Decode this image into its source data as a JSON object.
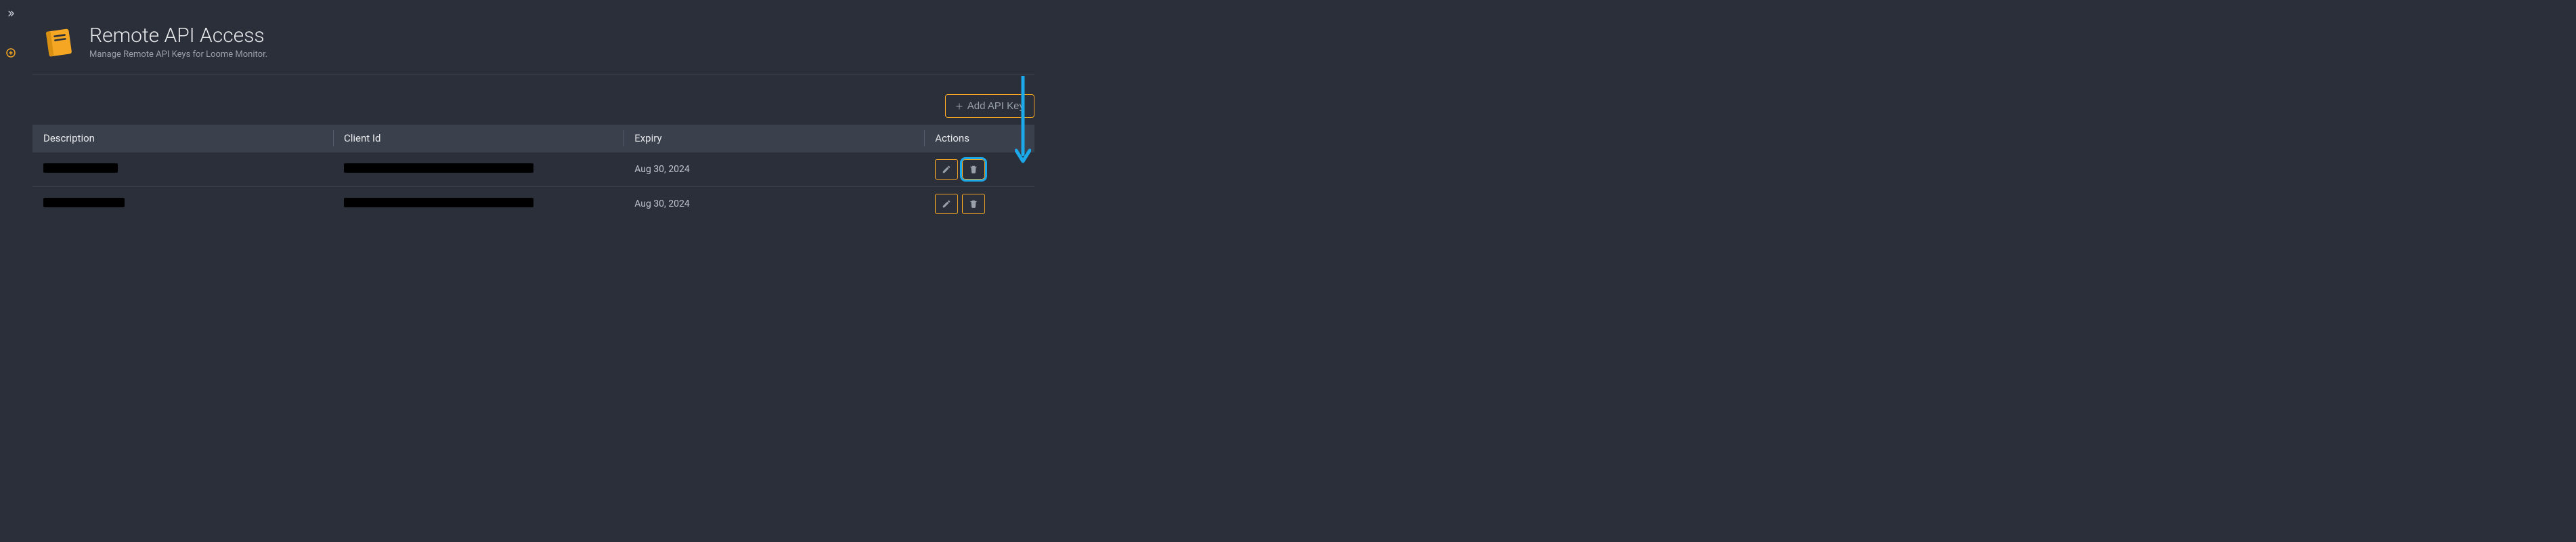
{
  "leftRail": {
    "expandTooltip": "Expand",
    "addTooltip": "Add"
  },
  "header": {
    "title": "Remote API Access",
    "subtitle": "Manage Remote API Keys for Loome Monitor."
  },
  "toolbar": {
    "addKeyLabel": "Add API Key"
  },
  "table": {
    "columns": {
      "description": "Description",
      "clientId": "Client Id",
      "expiry": "Expiry",
      "actions": "Actions"
    },
    "rows": [
      {
        "description": "",
        "clientId": "",
        "expiry": "Aug 30, 2024"
      },
      {
        "description": "",
        "clientId": "",
        "expiry": "Aug 30, 2024"
      }
    ]
  },
  "colors": {
    "accent": "#f5a623",
    "annotation": "#1ba9e9",
    "bg": "#2a2f3a"
  }
}
